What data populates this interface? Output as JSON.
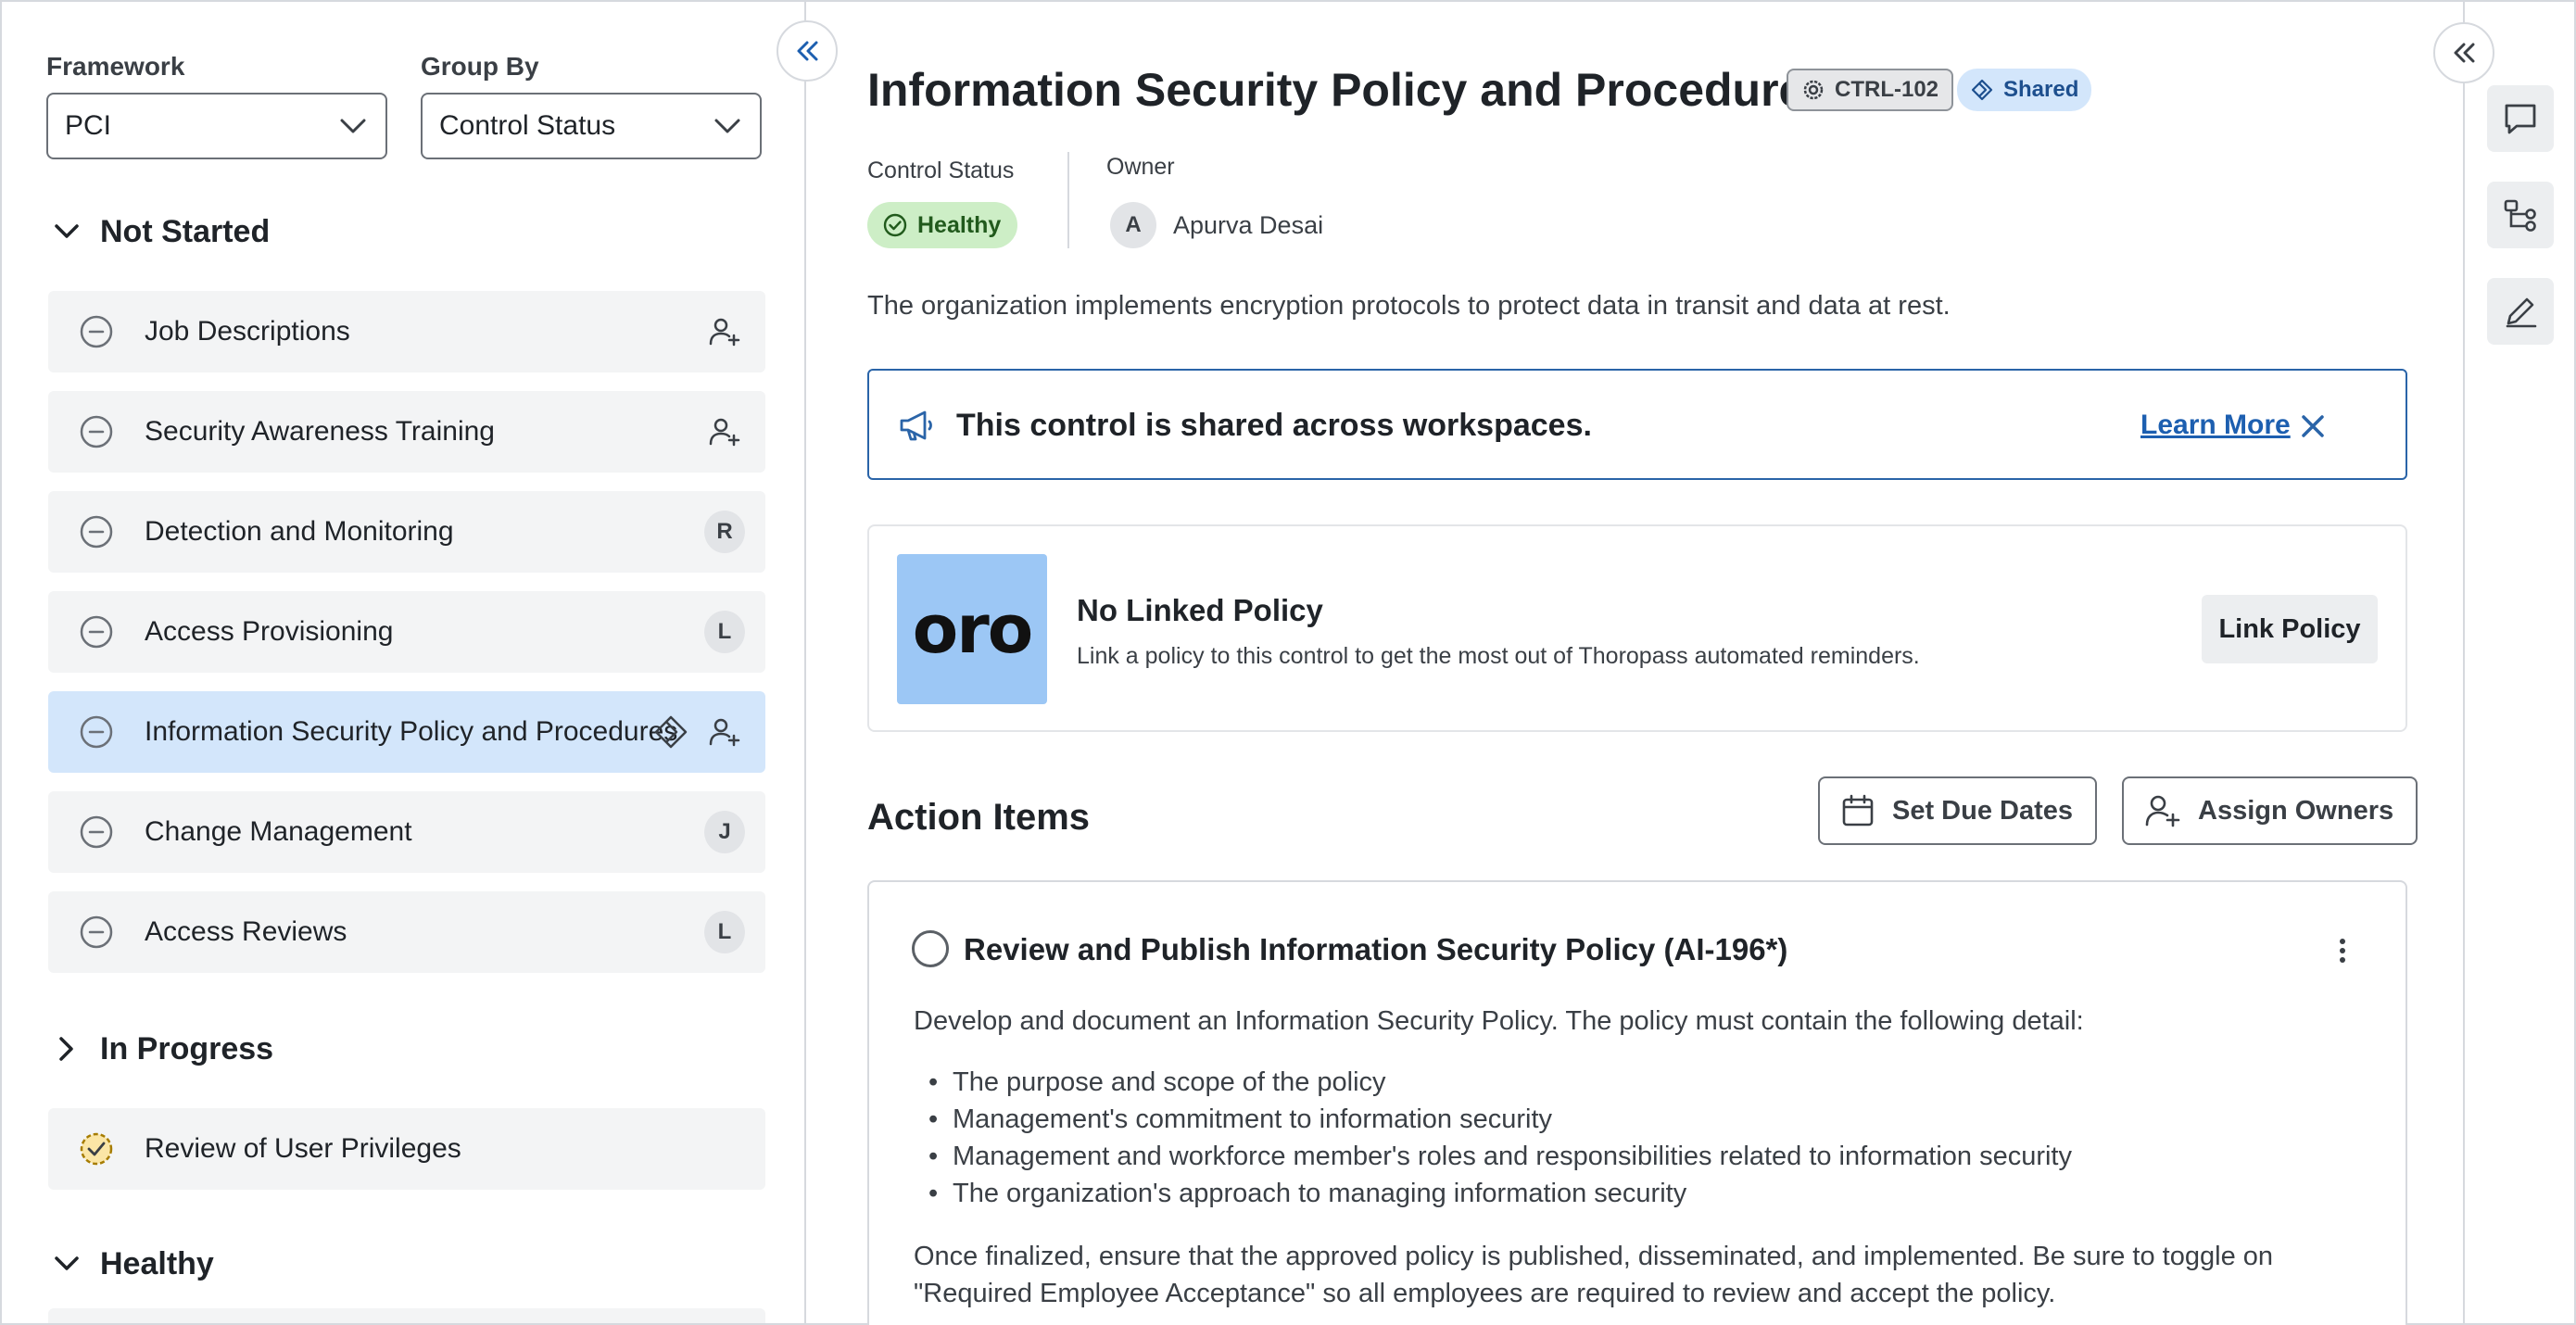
{
  "filters": {
    "framework": {
      "label": "Framework",
      "value": "PCI"
    },
    "group_by": {
      "label": "Group By",
      "value": "Control Status"
    }
  },
  "groups": [
    {
      "label": "Not Started",
      "expanded": true,
      "items": [
        {
          "label": "Job Descriptions",
          "status_icon": "minus-circle-icon",
          "assignee": "add-user-icon"
        },
        {
          "label": "Security Awareness Training",
          "status_icon": "minus-circle-icon",
          "assignee": "add-user-icon"
        },
        {
          "label": "Detection and Monitoring",
          "status_icon": "minus-circle-icon",
          "assignee": "R"
        },
        {
          "label": "Access Provisioning",
          "status_icon": "minus-circle-icon",
          "assignee": "L"
        },
        {
          "label": "Information Security Policy and Procedures",
          "status_icon": "minus-circle-icon",
          "assignee": "add-user-icon",
          "shared_icon": "shared-diamond-icon",
          "selected": true
        },
        {
          "label": "Change Management",
          "status_icon": "minus-circle-icon",
          "assignee": "J"
        },
        {
          "label": "Access Reviews",
          "status_icon": "minus-circle-icon",
          "assignee": "L"
        }
      ]
    },
    {
      "label": "In Progress",
      "expanded": false,
      "items": [
        {
          "label": "Review of User Privileges",
          "status_icon": "in-progress-check-icon"
        }
      ]
    },
    {
      "label": "Healthy",
      "expanded": true,
      "items": []
    }
  ],
  "control": {
    "title": "Information Security Policy and Procedures",
    "id_badge": "CTRL-102",
    "shared_badge": "Shared",
    "status_label": "Control Status",
    "status_value": "Healthy",
    "owner_label": "Owner",
    "owner_initial": "A",
    "owner_name": "Apurva Desai",
    "description": "The organization implements encryption protocols to protect data in transit and data at rest."
  },
  "banner": {
    "text": "This control is shared across workspaces.",
    "link": "Learn More"
  },
  "policy": {
    "logo_text": "oro",
    "title": "No Linked Policy",
    "subtitle": "Link a policy to this control to get the most out of Thoropass automated reminders.",
    "button": "Link Policy"
  },
  "action_items": {
    "title": "Action Items",
    "set_due_dates": "Set Due Dates",
    "assign_owners": "Assign Owners",
    "items": [
      {
        "title": "Review and Publish Information Security Policy (AI-196*)",
        "intro": "Develop and document an Information Security Policy. The policy must contain the following detail:",
        "bullets": [
          "The purpose and scope of the policy",
          "Management's commitment to information security",
          "Management and workforce member's roles and responsibilities related to information security",
          "The organization's approach to managing information security"
        ],
        "outro": "Once finalized, ensure that the approved policy is published, disseminated, and implemented. Be sure to toggle on \"Required Employee Acceptance\" so all employees are required to review and accept the policy."
      }
    ]
  },
  "icons": {
    "left_collapse": "double-chevron-left-icon",
    "right_collapse": "double-chevron-left-icon",
    "rail": [
      "comment-icon",
      "hierarchy-icon",
      "edit-pencil-icon"
    ]
  },
  "colors": {
    "accent": "#1d5fb0",
    "selected_row": "#d3e6fb",
    "healthy_pill": "#cdeec6",
    "logo_bg": "#9cc7f5"
  }
}
